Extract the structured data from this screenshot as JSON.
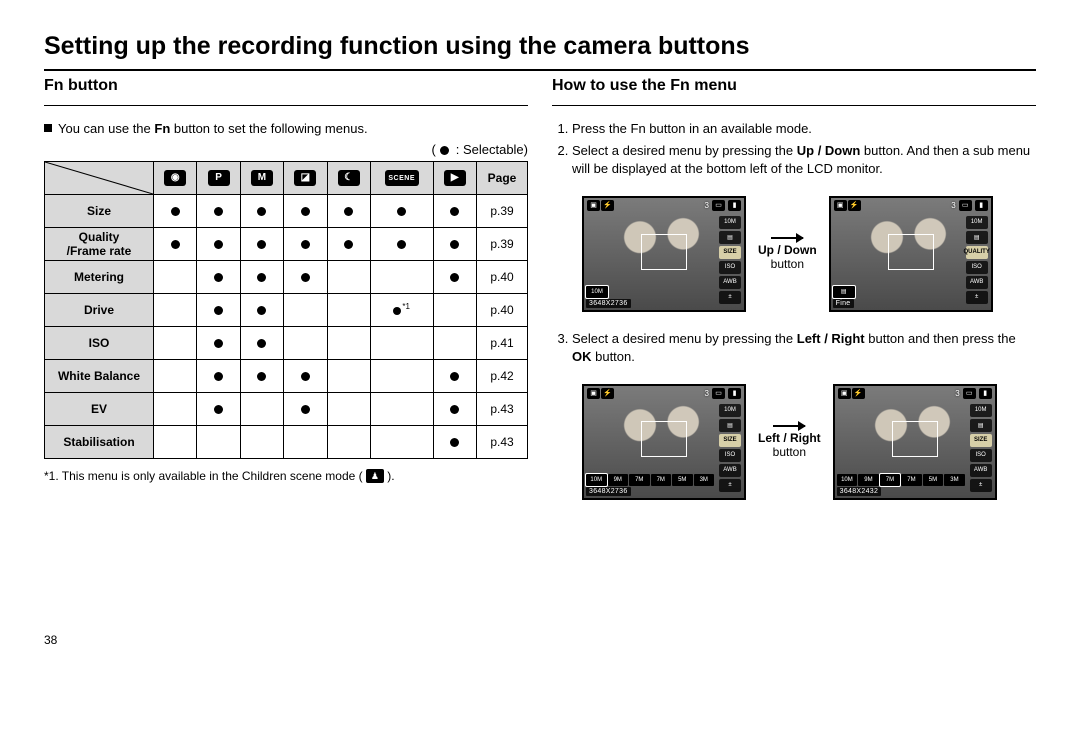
{
  "title": "Setting up the recording function using the camera buttons",
  "left": {
    "heading": "Fn button",
    "intro_prefix": "You can use the ",
    "intro_bold": "Fn",
    "intro_suffix": " button to set the following menus.",
    "legend": ": Selectable)",
    "mode_headers": [
      "",
      "P",
      "M",
      "",
      "",
      "SCENE",
      ""
    ],
    "mode_header_types": [
      "cam",
      "letter",
      "letter",
      "dual",
      "night",
      "scene",
      "movie"
    ],
    "page_header": "Page",
    "rows": [
      {
        "label": "Size",
        "cells": [
          "d",
          "d",
          "d",
          "d",
          "d",
          "d",
          "d"
        ],
        "page": "p.39"
      },
      {
        "label": "Quality\n/Frame rate",
        "cells": [
          "d",
          "d",
          "d",
          "d",
          "d",
          "d",
          "d"
        ],
        "page": "p.39"
      },
      {
        "label": "Metering",
        "cells": [
          "",
          "d",
          "d",
          "d",
          "",
          "",
          "d"
        ],
        "page": "p.40"
      },
      {
        "label": "Drive",
        "cells": [
          "",
          "d",
          "d",
          "",
          "",
          "s",
          ""
        ],
        "page": "p.40"
      },
      {
        "label": "ISO",
        "cells": [
          "",
          "d",
          "d",
          "",
          "",
          "",
          ""
        ],
        "page": "p.41"
      },
      {
        "label": "White Balance",
        "cells": [
          "",
          "d",
          "d",
          "d",
          "",
          "",
          "d"
        ],
        "page": "p.42"
      },
      {
        "label": "EV",
        "cells": [
          "",
          "d",
          "",
          "d",
          "",
          "",
          "d"
        ],
        "page": "p.43"
      },
      {
        "label": "Stabilisation",
        "cells": [
          "",
          "",
          "",
          "",
          "",
          "",
          "d"
        ],
        "page": "p.43"
      }
    ],
    "footnote_prefix": "*1. This menu is only available in the Children scene mode ( ",
    "footnote_suffix": " ).",
    "star_mark": "*1"
  },
  "right": {
    "heading": "How to use the Fn menu",
    "step1": "Press the Fn button in an available mode.",
    "step2_a": "Select a desired menu by pressing the ",
    "step2_b": "Up / Down",
    "step2_c": " button. And then a sub menu will be displayed at the bottom left of the LCD monitor.",
    "arrow1_b": "Up / Down",
    "arrow1": "button",
    "step3_a": "Select a desired menu by pressing the ",
    "step3_b": "Left / Right",
    "step3_c": " button and then press the ",
    "step3_d": "OK",
    "step3_e": " button.",
    "arrow2_b": "Left / Right",
    "arrow2": "button"
  },
  "lcd": {
    "top_num": "3",
    "badge10": "10M",
    "iso": "ISO",
    "awb": "AWB",
    "size": "SIZE",
    "quality": "QUALITY",
    "fine": "Fine",
    "res1": "3648X2736",
    "res2": "3648X2432",
    "thumbs": [
      "10M",
      "9M",
      "7M",
      "7M",
      "5M",
      "3M"
    ]
  },
  "page_number": "38"
}
